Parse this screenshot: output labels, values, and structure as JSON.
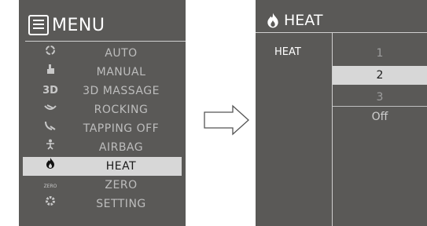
{
  "menu": {
    "title": "MENU",
    "items": [
      {
        "label": "AUTO",
        "icon": "refresh-icon"
      },
      {
        "label": "MANUAL",
        "icon": "hand-icon"
      },
      {
        "label": "3D MASSAGE",
        "icon": "3d-icon",
        "icon_text": "3D"
      },
      {
        "label": "ROCKING",
        "icon": "rocking-icon"
      },
      {
        "label": "TAPPING OFF",
        "icon": "tapping-icon"
      },
      {
        "label": "AIRBAG",
        "icon": "airbag-icon"
      },
      {
        "label": "HEAT",
        "icon": "flame-icon"
      },
      {
        "label": "ZERO",
        "icon": "zero-gravity-icon",
        "icon_text": "ZERO"
      },
      {
        "label": "SETTING",
        "icon": "gear-icon"
      }
    ],
    "selected_index": 6
  },
  "heat": {
    "title": "HEAT",
    "column_label": "HEAT",
    "options": [
      "1",
      "2",
      "3",
      "Off"
    ],
    "selected_index": 1
  },
  "colors": {
    "panel_bg": "#5a5957",
    "highlight": "#d7d7d7",
    "text_dim": "#bdbdbd"
  }
}
